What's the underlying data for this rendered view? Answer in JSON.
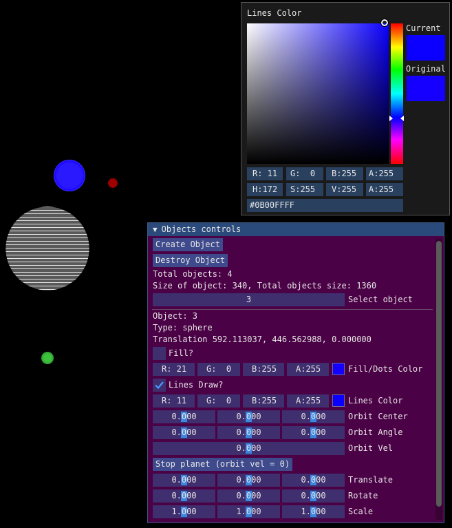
{
  "picker": {
    "title": "Lines Color",
    "current_label": "Current",
    "original_label": "Original",
    "hue_color": "#0b00ff",
    "current_color": "#0b00ff",
    "original_color": "#1500ff",
    "rgba": [
      "R: 11",
      "G:  0",
      "B:255",
      "A:255"
    ],
    "hsva": [
      "H:172",
      "S:255",
      "V:255",
      "A:255"
    ],
    "hex": "#0B00FFFF"
  },
  "window": {
    "title": "Objects controls",
    "create_button": "Create Object",
    "destroy_button": "Destroy Object",
    "total_objects": "Total objects: 4",
    "size_info": "Size of object: 340, Total objects size: 1360",
    "select_value": "3",
    "select_label": "Select object",
    "object_line": "Object: 3",
    "type_line": "Type: sphere",
    "translation_line": "Translation 592.113037, 446.562988, 0.000000",
    "fill_label": "Fill?",
    "fill_checked": false,
    "fill_rgba": [
      "R: 21",
      "G:  0",
      "B:255",
      "A:255"
    ],
    "fill_color": "#1500ff",
    "fill_color_label": "Fill/Dots Color",
    "lines_label": "Lines Draw?",
    "lines_checked": true,
    "lines_rgba": [
      "R: 11",
      "G:  0",
      "B:255",
      "A:255"
    ],
    "lines_color": "#0b00ff",
    "lines_color_label": "Lines Color",
    "orbit_center": [
      "0.000",
      "0.000",
      "0.000"
    ],
    "orbit_center_label": "Orbit Center",
    "orbit_angle": [
      "0.000",
      "0.000",
      "0.000"
    ],
    "orbit_angle_label": "Orbit Angle",
    "orbit_vel": "0.000",
    "orbit_vel_label": "Orbit Vel",
    "stop_button": "Stop planet (orbit vel = 0)",
    "translate": [
      "0.000",
      "0.000",
      "0.000"
    ],
    "translate_label": "Translate",
    "rotate": [
      "0.000",
      "0.000",
      "0.000"
    ],
    "rotate_label": "Rotate",
    "scale": [
      "1.000",
      "1.000",
      "1.000"
    ],
    "scale_label": "Scale"
  },
  "scene": {
    "blue_sphere_color": "#1500ff",
    "red_sphere_color": "#8b0000",
    "white_sphere_color": "#ffffff",
    "green_sphere_color": "#2ea82e"
  }
}
